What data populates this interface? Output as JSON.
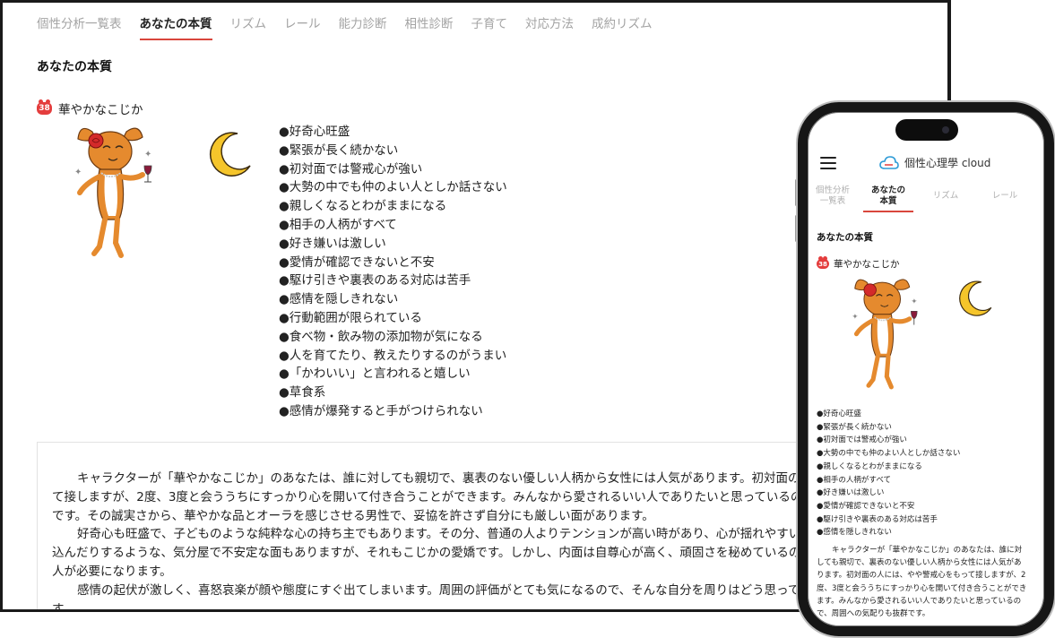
{
  "tabs": [
    "個性分析一覧表",
    "あなたの本質",
    "リズム",
    "レール",
    "能力診断",
    "相性診断",
    "子育て",
    "対応方法",
    "成約リズム"
  ],
  "active_tab": 1,
  "section_title": "あなたの本質",
  "character": {
    "number": "38",
    "name": "華やかなこじか"
  },
  "traits": [
    "●好奇心旺盛",
    "●緊張が長く続かない",
    "●初対面では警戒心が強い",
    "●大勢の中でも仲のよい人としか話さない",
    "●親しくなるとわがままになる",
    "●相手の人柄がすべて",
    "●好き嫌いは激しい",
    "●愛情が確認できないと不安",
    "●駆け引きや裏表のある対応は苦手",
    "●感情を隠しきれない",
    "●行動範囲が限られている",
    "●食べ物・飲み物の添加物が気になる",
    "●人を育てたり、教えたりするのがうまい",
    "●「かわいい」と言われると嬉しい",
    "●草食系",
    "●感情が爆発すると手がつけられない"
  ],
  "paragraphs": [
    "キャラクターが「華やかなこじか」のあなたは、誰に対しても親切で、裏表のない優しい人柄から女性には人気があります。初対面の人には、やや警戒心をもって接しますが、2度、3度と会ううちにすっかり心を開いて付き合うことができます。みんなから愛されるいい人でありたいと思っているので、周囲への気配りも抜群です。その誠実さから、華やかな品とオーラを感じさせる男性で、妥協を許さず自分にも厳しい面があります。",
    "好奇心も旺盛で、子どものような純粋な心の持ち主でもあります。その分、普通の人よりテンションが高い時があり、心が揺れやすい面もあります。すぐに落ち込んだりするような、気分屋で不安定な面もありますが、それもこじかの愛嬌です。しかし、内面は自尊心が高く、頑固さを秘めているので、そこを理解してくれる人が必要になります。",
    "感情の起伏が激しく、喜怒哀楽が顔や態度にすぐ出てしまいます。周囲の評価がとても気になるので、そんな自分を周りはどう思っているのか気にしてしまいます。"
  ],
  "phone": {
    "app_title": "個性心理學 cloud",
    "tabs": [
      "個性分析\n一覧表",
      "あなたの\n本質",
      "リズム",
      "レール"
    ],
    "active_tab": 1,
    "visible_traits": 10,
    "paragraph": "キャラクターが「華やかなこじか」のあなたは、誰に対しても親切で、裏表のない優しい人柄から女性には人気があります。初対面の人には、やや警戒心をもって接しますが、2度、3度と会ううちにすっかり心を開いて付き合うことができます。みんなから愛されるいい人でありたいと思っているので、周囲への気配りも抜群です。"
  },
  "colors": {
    "accent": "#d9463c",
    "badge": "#e43d3d",
    "deer": "#e58a2e",
    "moon": "#f5c52b",
    "rose": "#d42a2a"
  }
}
